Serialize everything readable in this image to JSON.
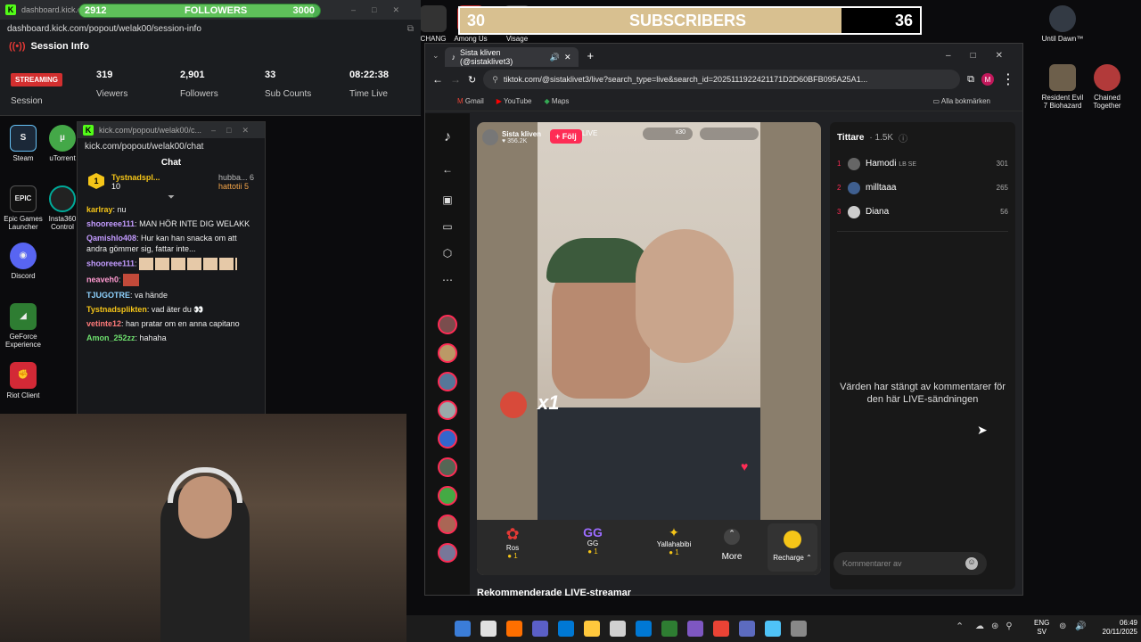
{
  "desktop_icons": [
    {
      "label": "Steam",
      "color": "#1b2838"
    },
    {
      "label": "uTorrent",
      "color": "#44a848"
    },
    {
      "label": "Epic Games Launcher",
      "color": "#111111"
    },
    {
      "label": "Insta360 Control",
      "color": "#222222"
    },
    {
      "label": "Discord",
      "color": "#5865f2"
    },
    {
      "label": "GeForce Experience",
      "color": "#2e7d32"
    },
    {
      "label": "Riot Client",
      "color": "#d32936"
    },
    {
      "label": "CHANG -",
      "color": "#333333"
    },
    {
      "label": "Among Us",
      "color": "#c62828"
    },
    {
      "label": "Visage",
      "color": "#444444"
    },
    {
      "label": "Until Dawn™",
      "color": "#333a44"
    },
    {
      "label": "Resident Evil 7 Biohazard",
      "color": "#6d5f4b"
    },
    {
      "label": "Chained Together",
      "color": "#b23a3a"
    }
  ],
  "overlay": {
    "followers": {
      "current": "2912",
      "label": "FOLLOWERS",
      "goal": "3000",
      "progress": 0.97
    },
    "subscribers": {
      "current": "30",
      "label": "SUBSCRIBERS",
      "goal": "36",
      "progress": 0.83
    }
  },
  "session": {
    "title_url": "dashboard.kick.com",
    "url": "dashboard.kick.com/popout/welak00/session-info",
    "heading": "Session Info",
    "badge": "STREAMING",
    "session_label": "Session",
    "stats": [
      {
        "value": "319",
        "label": "Viewers"
      },
      {
        "value": "2,901",
        "label": "Followers"
      },
      {
        "value": "33",
        "label": "Sub Counts"
      },
      {
        "value": "08:22:38",
        "label": "Time Live"
      }
    ]
  },
  "chat": {
    "title_url": "kick.com/popout/welak00/c...",
    "url": "kick.com/popout/welak00/chat",
    "heading": "Chat",
    "top_gifter": {
      "name": "Tystnadspl...",
      "count": "10"
    },
    "gifters": [
      {
        "name": "hubba...",
        "count": "6"
      },
      {
        "name": "hattotii",
        "count": "5"
      }
    ],
    "messages": [
      {
        "user": "karlray",
        "text": "nu",
        "color": "#f5c518"
      },
      {
        "user": "shooreee111",
        "text": "MAN HÖR INTE DIG WELAKK",
        "color": "#c39bff"
      },
      {
        "user": "Qamishlo408",
        "text": "Hur kan han snacka om att andra gömmer sig, fattar inte...",
        "color": "#c39bff"
      },
      {
        "user": "shooreee111",
        "text": "",
        "color": "#c39bff"
      },
      {
        "user": "neaveh0",
        "text": "",
        "color": "#ff9ad0"
      },
      {
        "user": "TJUGOTRE",
        "text": "va hände",
        "color": "#8fd3ff"
      },
      {
        "user": "Tystnadsplikten",
        "text": "vad äter du 👀",
        "color": "#f5c518"
      },
      {
        "user": "vetinte12",
        "text": "han pratar om en anna capitano",
        "color": "#ff7a7a"
      },
      {
        "user": "Amon_252zz",
        "text": "hahaha",
        "color": "#6ee06e"
      }
    ]
  },
  "chrome": {
    "tab_title": "Sista kliven (@sistaklivet3)",
    "url": "tiktok.com/@sistaklivet3/live?search_type=live&search_id=2025111922421171D2D60BFB095A25A1...",
    "bookmarks": [
      "Gmail",
      "YouTube",
      "Maps"
    ],
    "all_bookmarks": "Alla bokmärken"
  },
  "tiktok": {
    "host_name": "Sista kliven",
    "host_likes": "356.2K",
    "follow": "+ Följ",
    "live_tag": "LIVE",
    "multiplier": "x30",
    "combo": "x1",
    "gifts": [
      {
        "name": "Ros",
        "cost": "1"
      },
      {
        "name": "GG",
        "cost": "1"
      },
      {
        "name": "Yallahabibi",
        "cost": "1"
      }
    ],
    "more": "More",
    "recharge": "Recharge",
    "recommended": "Rekommenderade LIVE-streamar",
    "viewers_title": "Tittare",
    "viewers_count": "1.5K",
    "viewers": [
      {
        "rank": "1",
        "name": "Hamodi",
        "tag": "LB SE",
        "points": "301"
      },
      {
        "rank": "2",
        "name": "milltaaa",
        "tag": "",
        "points": "265"
      },
      {
        "rank": "3",
        "name": "Diana",
        "tag": "",
        "points": "56"
      }
    ],
    "comments_off_msg": "Värden har stängt av kommentarer för den här LIVE-sändningen",
    "comment_placeholder": "Kommentarer av"
  },
  "taskbar": {
    "lang": "ENG",
    "region": "SV",
    "time": "06:49",
    "date": "20/11/2025",
    "apps": [
      "#3b7dd8",
      "#e0e0e0",
      "#ff6f00",
      "#5b5fc7",
      "#0078d4",
      "#ffc83d",
      "#d0d0d0",
      "#0078d4",
      "#2e7d32",
      "#7e57c2",
      "#ea4335",
      "#5c6bc0",
      "#4fc3f7",
      "#888888"
    ]
  }
}
